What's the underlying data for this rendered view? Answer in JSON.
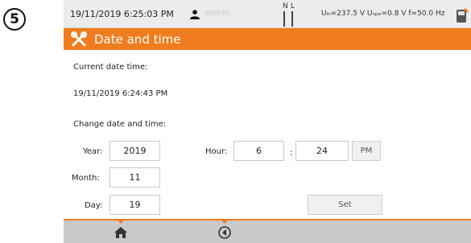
{
  "step_number": "5",
  "status": {
    "datetime": "19/11/2019 6:25:03 PM",
    "user": "admin",
    "phase_n": "N",
    "phase_l": "L",
    "measurements": "Uₗₙ=237.5 V Uₙₚₑ=0.8 V f=50.0 Hz"
  },
  "header": {
    "title": "Date and time"
  },
  "content": {
    "current_label": "Current date time:",
    "current_value": "19/11/2019 6:24:43 PM",
    "change_label": "Change date and time:",
    "year_label": "Year:",
    "year_value": "2019",
    "month_label": "Month:",
    "month_value": "11",
    "day_label": "Day:",
    "day_value": "19",
    "hour_label": "Hour:",
    "hour_value": "6",
    "separator": ":",
    "minute_value": "24",
    "ampm_label": "PM",
    "set_label": "Set"
  },
  "colors": {
    "accent": "#ef7d1f",
    "statusbar": "#ececec",
    "bottombar": "#c9c9c9"
  },
  "icons": {
    "title": "tools-icon",
    "user": "user-icon",
    "meter": "meter-icon",
    "home": "home-icon",
    "back": "back-icon"
  }
}
